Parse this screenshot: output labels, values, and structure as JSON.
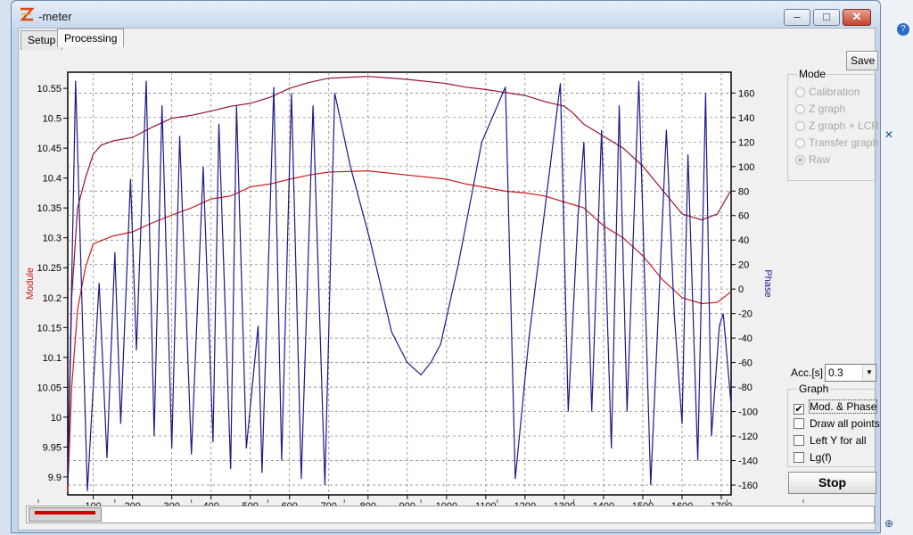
{
  "window": {
    "title": "-meter",
    "minimize": "–",
    "maximize": "□",
    "close": "✕"
  },
  "tabs": [
    {
      "label": "Setup"
    },
    {
      "label": "Processing"
    }
  ],
  "save_label": "Save",
  "mode": {
    "title": "Mode",
    "options": [
      {
        "label": "Calibration"
      },
      {
        "label": "Z graph"
      },
      {
        "label": "Z graph + LCR"
      },
      {
        "label": "Transfer graph"
      },
      {
        "label": "Raw"
      }
    ],
    "selected": "Raw"
  },
  "acc": {
    "label": "Acc.[s]",
    "value": "0.3"
  },
  "graph_options": {
    "title": "Graph",
    "items": [
      {
        "label": "Mod. & Phase",
        "checked": true
      },
      {
        "label": "Draw all points",
        "checked": false
      },
      {
        "label": "Left Y for all",
        "checked": false
      },
      {
        "label": "Lg(f)",
        "checked": false
      }
    ]
  },
  "stop_label": "Stop",
  "chart_data": {
    "type": "line",
    "xlabel": "",
    "ylabel_left": "Module",
    "ylabel_right": "Phase",
    "grid": true,
    "x_ticks": [
      100,
      200,
      300,
      400,
      500,
      600,
      700,
      800,
      900,
      1000,
      1100,
      1200,
      1300,
      1400,
      1500,
      1600,
      1700
    ],
    "xlim": [
      35,
      1725
    ],
    "left_ticks": [
      "10.55",
      "10.5",
      "10.45",
      "10.4",
      "10.35",
      "10.3",
      "10.25",
      "10.2",
      "10.15",
      "10.1",
      "10.05",
      "10",
      "9.95",
      "9.9"
    ],
    "left_lim": [
      9.87,
      10.577
    ],
    "right_ticks": [
      160,
      140,
      120,
      100,
      80,
      60,
      40,
      20,
      0,
      -20,
      -40,
      -60,
      -80,
      -100,
      -120,
      -140,
      -160
    ],
    "right_lim": [
      -168,
      177
    ],
    "bottom_axis_ticks": [
      0,
      2000,
      4000,
      6000,
      8000,
      10000,
      12000,
      14000,
      16000,
      18000,
      20000
    ],
    "series": [
      {
        "axis": "left",
        "color": "#9a1030",
        "points": [
          [
            35,
            9.875
          ],
          [
            45,
            10.2
          ],
          [
            60,
            10.35
          ],
          [
            80,
            10.4
          ],
          [
            100,
            10.44
          ],
          [
            120,
            10.455
          ],
          [
            150,
            10.462
          ],
          [
            200,
            10.468
          ],
          [
            250,
            10.485
          ],
          [
            300,
            10.5
          ],
          [
            350,
            10.505
          ],
          [
            400,
            10.512
          ],
          [
            450,
            10.52
          ],
          [
            500,
            10.525
          ],
          [
            550,
            10.535
          ],
          [
            600,
            10.55
          ],
          [
            650,
            10.56
          ],
          [
            700,
            10.567
          ],
          [
            800,
            10.57
          ],
          [
            900,
            10.565
          ],
          [
            1000,
            10.558
          ],
          [
            1050,
            10.552
          ],
          [
            1100,
            10.548
          ],
          [
            1150,
            10.543
          ],
          [
            1200,
            10.538
          ],
          [
            1250,
            10.528
          ],
          [
            1300,
            10.52
          ],
          [
            1320,
            10.51
          ],
          [
            1350,
            10.49
          ],
          [
            1400,
            10.47
          ],
          [
            1450,
            10.45
          ],
          [
            1500,
            10.42
          ],
          [
            1550,
            10.38
          ],
          [
            1600,
            10.34
          ],
          [
            1650,
            10.33
          ],
          [
            1690,
            10.34
          ],
          [
            1725,
            10.38
          ]
        ]
      },
      {
        "axis": "left",
        "color": "#d01818",
        "points": [
          [
            35,
            9.88
          ],
          [
            45,
            10.05
          ],
          [
            60,
            10.18
          ],
          [
            80,
            10.25
          ],
          [
            100,
            10.29
          ],
          [
            150,
            10.303
          ],
          [
            200,
            10.31
          ],
          [
            250,
            10.325
          ],
          [
            300,
            10.338
          ],
          [
            350,
            10.35
          ],
          [
            400,
            10.365
          ],
          [
            450,
            10.37
          ],
          [
            500,
            10.385
          ],
          [
            550,
            10.39
          ],
          [
            600,
            10.398
          ],
          [
            650,
            10.405
          ],
          [
            700,
            10.41
          ],
          [
            800,
            10.412
          ],
          [
            900,
            10.405
          ],
          [
            1000,
            10.398
          ],
          [
            1050,
            10.39
          ],
          [
            1100,
            10.384
          ],
          [
            1150,
            10.378
          ],
          [
            1200,
            10.375
          ],
          [
            1250,
            10.37
          ],
          [
            1300,
            10.36
          ],
          [
            1350,
            10.35
          ],
          [
            1400,
            10.32
          ],
          [
            1450,
            10.3
          ],
          [
            1500,
            10.27
          ],
          [
            1550,
            10.23
          ],
          [
            1600,
            10.2
          ],
          [
            1650,
            10.19
          ],
          [
            1690,
            10.192
          ],
          [
            1725,
            10.21
          ]
        ]
      },
      {
        "axis": "right",
        "color": "#1a1a8a",
        "points": [
          [
            35,
            -160
          ],
          [
            55,
            170
          ],
          [
            85,
            -165
          ],
          [
            115,
            5
          ],
          [
            135,
            -138
          ],
          [
            155,
            30
          ],
          [
            170,
            -110
          ],
          [
            195,
            90
          ],
          [
            210,
            -50
          ],
          [
            235,
            170
          ],
          [
            255,
            -120
          ],
          [
            275,
            150
          ],
          [
            300,
            -130
          ],
          [
            320,
            125
          ],
          [
            350,
            -135
          ],
          [
            380,
            100
          ],
          [
            405,
            -125
          ],
          [
            420,
            135
          ],
          [
            450,
            -147
          ],
          [
            465,
            150
          ],
          [
            490,
            -130
          ],
          [
            520,
            -30
          ],
          [
            530,
            -150
          ],
          [
            560,
            165
          ],
          [
            580,
            -140
          ],
          [
            605,
            160
          ],
          [
            630,
            -155
          ],
          [
            660,
            150
          ],
          [
            690,
            -160
          ],
          [
            715,
            160
          ],
          [
            755,
            100
          ],
          [
            805,
            40
          ],
          [
            860,
            -35
          ],
          [
            900,
            -60
          ],
          [
            935,
            -70
          ],
          [
            960,
            -60
          ],
          [
            985,
            -45
          ],
          [
            1030,
            20
          ],
          [
            1090,
            120
          ],
          [
            1150,
            165
          ],
          [
            1175,
            -155
          ],
          [
            1210,
            -40
          ],
          [
            1290,
            168
          ],
          [
            1310,
            -100
          ],
          [
            1335,
            60
          ],
          [
            1350,
            120
          ],
          [
            1370,
            -100
          ],
          [
            1395,
            130
          ],
          [
            1420,
            -130
          ],
          [
            1440,
            150
          ],
          [
            1460,
            -100
          ],
          [
            1490,
            170
          ],
          [
            1520,
            -160
          ],
          [
            1560,
            130
          ],
          [
            1580,
            -20
          ],
          [
            1600,
            -110
          ],
          [
            1615,
            110
          ],
          [
            1640,
            -140
          ],
          [
            1660,
            160
          ],
          [
            1675,
            -120
          ],
          [
            1695,
            -30
          ],
          [
            1705,
            -20
          ],
          [
            1725,
            -95
          ]
        ]
      }
    ]
  }
}
